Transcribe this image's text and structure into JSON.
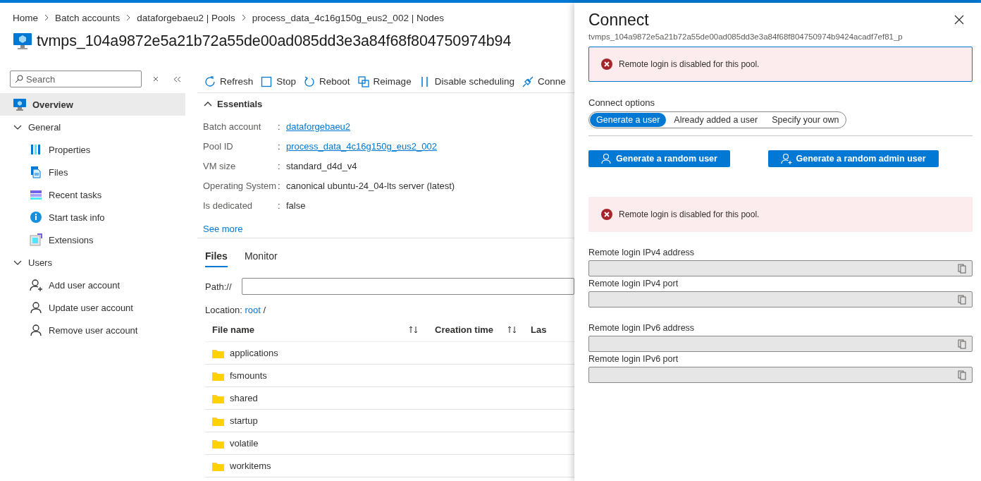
{
  "breadcrumb": [
    "Home",
    "Batch accounts",
    "dataforgebaeu2 | Pools",
    "process_data_4c16g150g_eus2_002 | Nodes"
  ],
  "page_title": "tvmps_104a9872e5a21b72a55de00ad085dd3e3a84f68f804750974b94",
  "sidebar": {
    "search": {
      "placeholder": "Search"
    },
    "items": [
      {
        "label": "Overview",
        "selected": true
      },
      {
        "label": "General",
        "expanded": true,
        "children": [
          {
            "label": "Properties",
            "selected": false
          },
          {
            "label": "Files",
            "selected": false
          },
          {
            "label": "Recent tasks",
            "selected": false
          },
          {
            "label": "Start task info",
            "selected": false
          },
          {
            "label": "Extensions",
            "selected": false
          }
        ]
      },
      {
        "label": "Users",
        "expanded": true,
        "children": [
          {
            "label": "Add user account",
            "selected": false
          },
          {
            "label": "Update user account",
            "selected": false
          },
          {
            "label": "Remove user account",
            "selected": false
          }
        ]
      }
    ]
  },
  "toolbar": [
    "Refresh",
    "Stop",
    "Reboot",
    "Reimage",
    "Disable scheduling",
    "Conne"
  ],
  "essentials": {
    "title": "Essentials",
    "expanded": true,
    "rows": [
      {
        "label": "Batch account",
        "separator": ":",
        "value": "dataforgebaeu2",
        "kind": "link"
      },
      {
        "label": "Pool ID",
        "separator": ":",
        "value": "process_data_4c16g150g_eus2_002",
        "kind": "link"
      },
      {
        "label": "VM size",
        "separator": ":",
        "value": "standard_d4d_v4",
        "kind": "text"
      },
      {
        "label": "Operating System",
        "separator": ":",
        "value": "canonical ubuntu-24_04-lts server (latest)",
        "kind": "text"
      },
      {
        "label": "Is dedicated",
        "separator": ":",
        "value": "false",
        "kind": "text"
      }
    ],
    "see_more": "See more"
  },
  "tabs": [
    {
      "label": "Files",
      "selected": true
    },
    {
      "label": "Monitor",
      "selected": false
    }
  ],
  "path": {
    "label": "Path://"
  },
  "location": {
    "label": "Location:",
    "link": "root",
    "suffix": "/"
  },
  "table": {
    "columns": [
      {
        "label": "File name",
        "sortable": true
      },
      {
        "label": "Creation time",
        "sortable": true
      },
      {
        "label": "Las",
        "sortable": false
      }
    ],
    "rows": [
      "applications",
      "fsmounts",
      "shared",
      "startup",
      "volatile",
      "workitems"
    ]
  },
  "connect_panel": {
    "title": "Connect",
    "subtitle": "tvmps_104a9872e5a21b72a55de00ad085dd3e3a84f68f804750974b9424acadf7ef81_p",
    "alert": {
      "text": "Remote login is disabled for this pool.",
      "focused": true
    },
    "options_label": "Connect options",
    "options": [
      {
        "label": "Generate a user",
        "selected": true
      },
      {
        "label": "Already added a user",
        "selected": false
      },
      {
        "label": "Specify your own",
        "selected": false
      }
    ],
    "buttons": [
      {
        "label": "Generate a random user",
        "kind": "user"
      },
      {
        "label": "Generate a random admin user",
        "kind": "admin"
      }
    ],
    "alert2": {
      "text": "Remote login is disabled for this pool.",
      "focused": false
    },
    "fields": [
      {
        "label": "Remote login IPv4 address",
        "disabled": true
      },
      {
        "label": "Remote login IPv4 port",
        "disabled": true
      },
      {
        "label": "Remote login IPv6 address",
        "disabled": true
      },
      {
        "label": "Remote login IPv6 port",
        "disabled": true
      }
    ]
  }
}
